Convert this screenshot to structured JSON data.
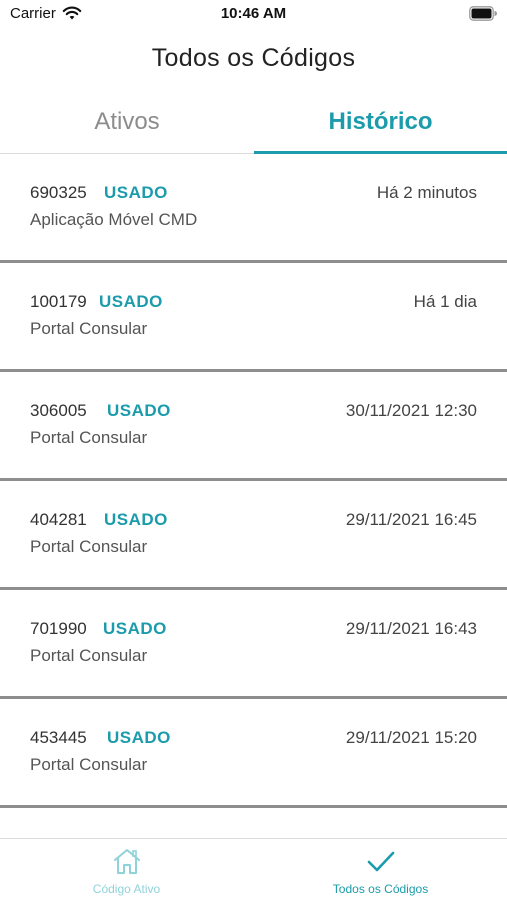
{
  "status_bar": {
    "carrier": "Carrier",
    "time": "10:46 AM"
  },
  "nav": {
    "title": "Todos os Códigos"
  },
  "tabs": [
    {
      "label": "Ativos",
      "selected": false
    },
    {
      "label": "Histórico",
      "selected": true
    }
  ],
  "history": [
    {
      "code": "690325",
      "status": "USADO",
      "when": "Há 2 minutos",
      "origin": "Aplicação Móvel CMD"
    },
    {
      "code": "100179",
      "status": "USADO",
      "when": "Há 1 dia",
      "origin": "Portal Consular"
    },
    {
      "code": "306005",
      "status": "USADO",
      "when": "30/11/2021 12:30",
      "origin": "Portal Consular"
    },
    {
      "code": "404281",
      "status": "USADO",
      "when": "29/11/2021 16:45",
      "origin": "Portal Consular"
    },
    {
      "code": "701990",
      "status": "USADO",
      "when": "29/11/2021 16:43",
      "origin": "Portal Consular"
    },
    {
      "code": "453445",
      "status": "USADO",
      "when": "29/11/2021 15:20",
      "origin": "Portal Consular"
    }
  ],
  "tab_bar": {
    "items": [
      {
        "label": "Código Ativo",
        "icon": "home-icon",
        "selected": false
      },
      {
        "label": "Todos os Códigos",
        "icon": "checkmark-icon",
        "selected": true
      }
    ]
  },
  "colors": {
    "accent": "#1b9bab",
    "accent_light": "#8fd3da",
    "inactive_tab": "#8c8c8c",
    "separator": "#8e8e8e"
  }
}
